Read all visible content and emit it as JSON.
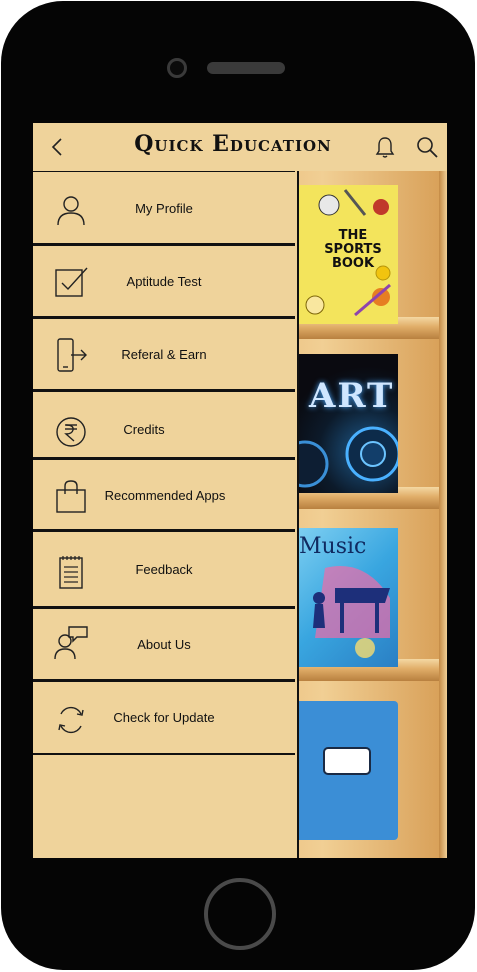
{
  "header": {
    "title": "Quick Education"
  },
  "drawer": {
    "items": [
      {
        "label": "My Profile",
        "icon": "user-icon"
      },
      {
        "label": "Aptitude Test",
        "icon": "checkbox-icon"
      },
      {
        "label": "Referal & Earn",
        "icon": "phone-share-icon"
      },
      {
        "label": "Credits",
        "icon": "rupee-icon"
      },
      {
        "label": "Recommended Apps",
        "icon": "shopping-bag-icon"
      },
      {
        "label": "Feedback",
        "icon": "notepad-icon"
      },
      {
        "label": "About Us",
        "icon": "chat-user-icon"
      },
      {
        "label": "Check for Update",
        "icon": "refresh-icon"
      }
    ]
  },
  "books": [
    {
      "title": "THE SPORTS BOOK"
    },
    {
      "title": "ART"
    },
    {
      "title": "Music"
    },
    {
      "title": ""
    }
  ],
  "colors": {
    "drawer_bg": "#efd39b",
    "shelf_wood": "#e6c07f",
    "phone_body": "#050505"
  }
}
